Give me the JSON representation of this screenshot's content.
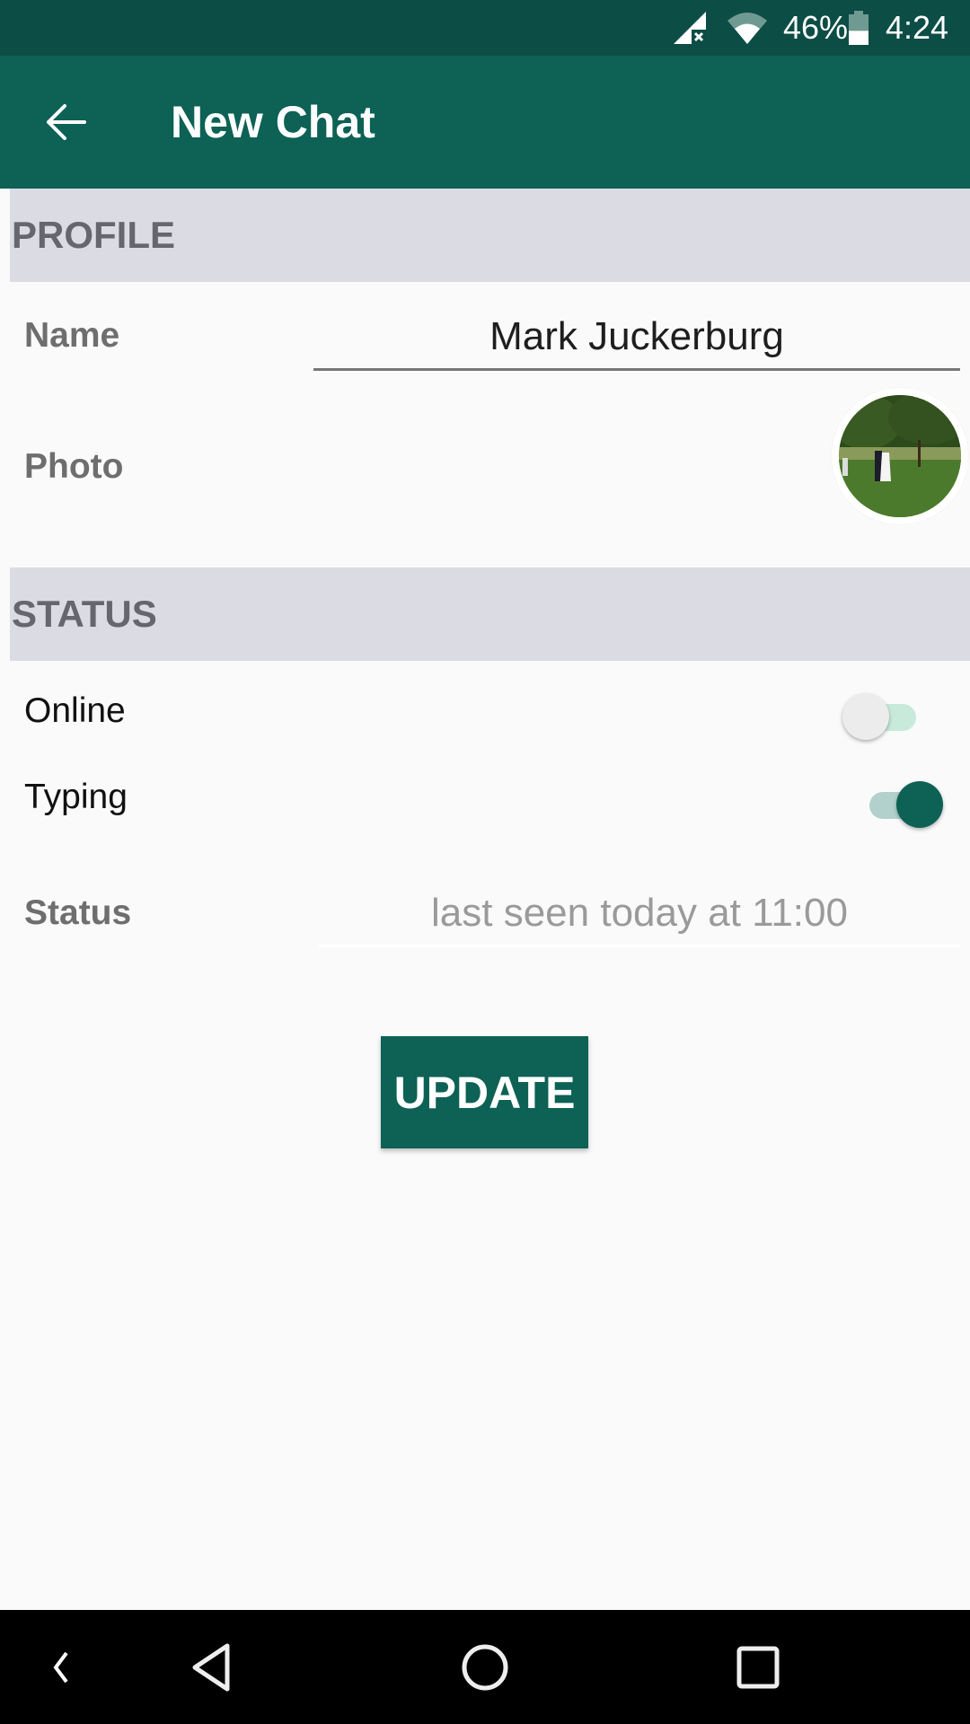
{
  "status_bar": {
    "battery_percent": "46%",
    "battery_level": 0.46,
    "time": "4:24",
    "icons": [
      "signal-no-service-icon",
      "wifi-icon",
      "battery-icon"
    ]
  },
  "toolbar": {
    "title": "New Chat",
    "back_icon": "arrow-left-icon"
  },
  "profile_section": {
    "header": "PROFILE",
    "name_label": "Name",
    "name_value": "Mark Juckerburg",
    "photo_label": "Photo"
  },
  "status_section": {
    "header": "STATUS",
    "online_label": "Online",
    "online_on": false,
    "typing_label": "Typing",
    "typing_on": true,
    "status_label": "Status",
    "status_value": "last seen today at 11:00"
  },
  "actions": {
    "update_label": "UPDATE"
  },
  "colors": {
    "primary": "#0d6155",
    "primary_dark": "#0c4d45",
    "section_bg": "#dbdbe3",
    "toggle_on_track": "#b3d1cc",
    "toggle_off_track": "#c8eadb",
    "toggle_off_thumb": "#ececec"
  },
  "nav_bar": {
    "buttons": [
      "collapse-chevron-icon",
      "back-triangle-icon",
      "home-circle-icon",
      "recents-square-icon"
    ]
  }
}
